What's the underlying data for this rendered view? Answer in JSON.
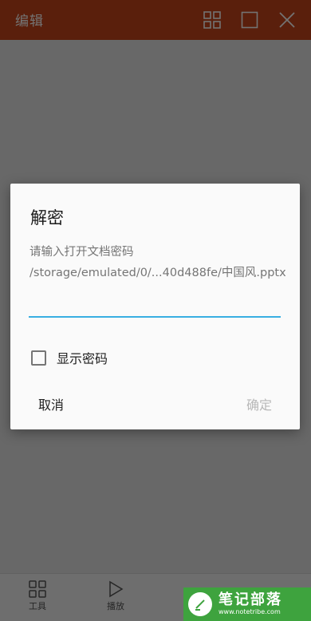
{
  "app_bar": {
    "title": "编辑",
    "icons": [
      "grid-icon",
      "square-icon",
      "close-icon"
    ]
  },
  "bottom_bar": {
    "items": [
      {
        "label": "工具",
        "icon": "tools-grid-icon"
      },
      {
        "label": "播放",
        "icon": "play-icon"
      }
    ]
  },
  "dialog": {
    "title": "解密",
    "message": "请输入打开文档密码",
    "path": "/storage/emulated/0/...40d488fe/中国风.pptx",
    "password": {
      "value": "",
      "placeholder": ""
    },
    "show_password_label": "显示密码",
    "show_password_checked": false,
    "cancel_label": "取消",
    "confirm_label": "确定"
  },
  "watermark": {
    "title": "笔记部落",
    "url": "www.notetribe.com"
  },
  "colors": {
    "app_bar": "#c8461b",
    "input_underline": "#38aee2",
    "confirm_disabled": "#b8b8b8",
    "watermark_bg": "#3ea33e"
  }
}
